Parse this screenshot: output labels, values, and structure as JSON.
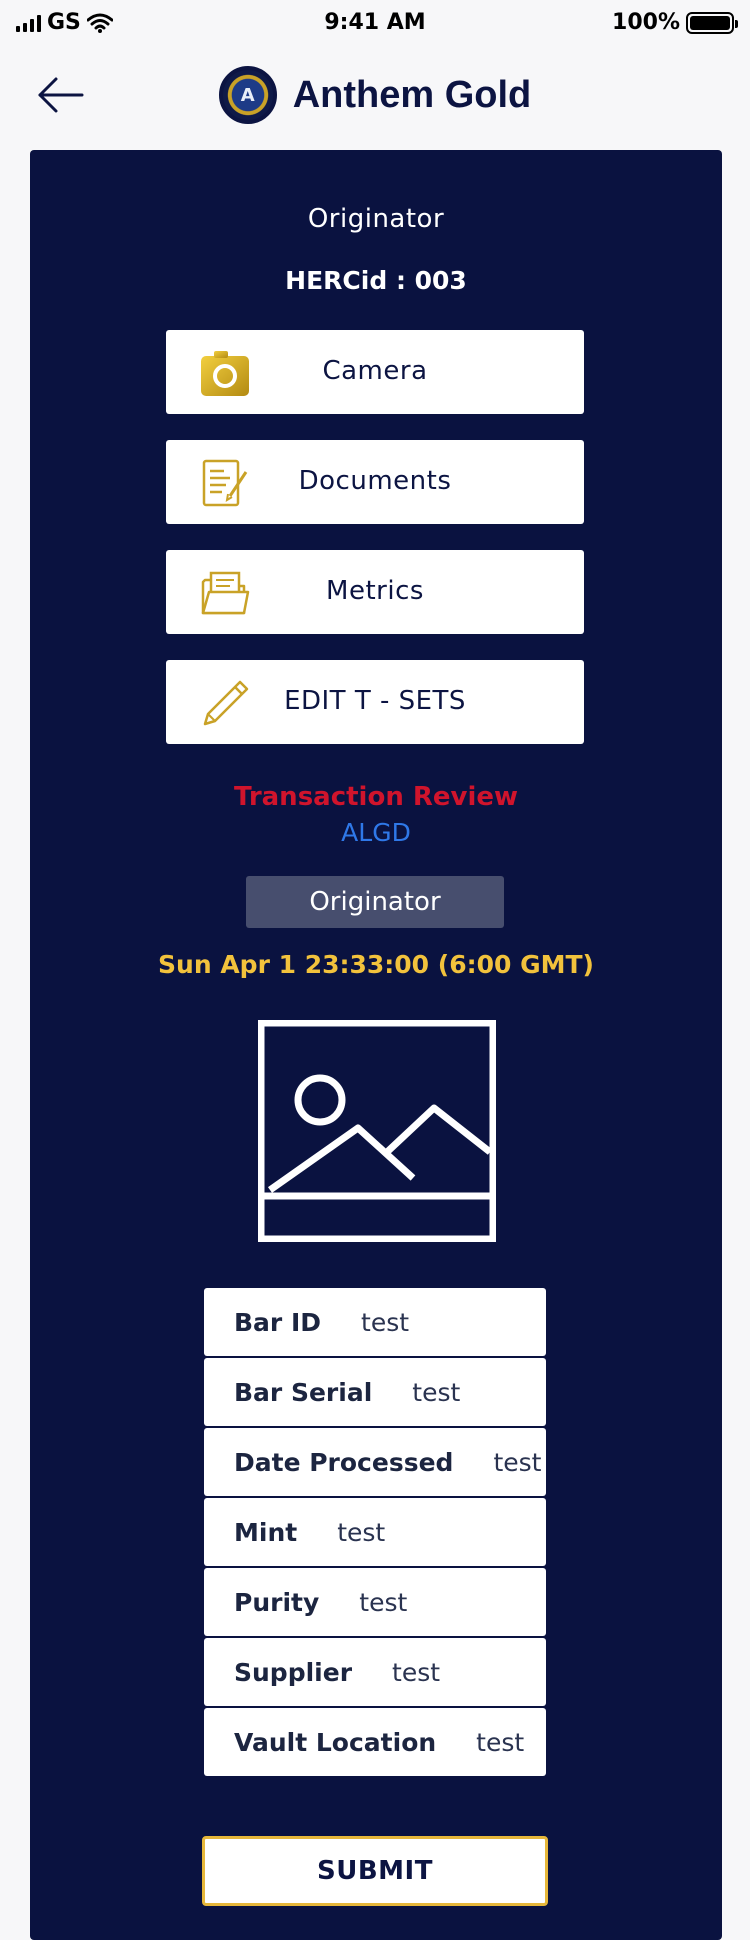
{
  "status_bar": {
    "carrier": "GS",
    "time": "9:41 AM",
    "battery": "100%"
  },
  "header": {
    "title": "Anthem Gold",
    "logo_text": "A"
  },
  "panel": {
    "role": "Originator",
    "hercid": "HERCid : 003",
    "buttons": [
      {
        "label": "Camera",
        "icon": "camera-icon"
      },
      {
        "label": "Documents",
        "icon": "document-icon"
      },
      {
        "label": "Metrics",
        "icon": "folder-icon"
      },
      {
        "label": "EDIT T - SETS",
        "icon": "pencil-icon"
      }
    ],
    "transaction_review": "Transaction Review",
    "currency": "ALGD",
    "role_badge": "Originator",
    "timestamp": "Sun Apr 1 23:33:00 (6:00 GMT)",
    "details": [
      {
        "key": "Bar ID",
        "value": "test"
      },
      {
        "key": "Bar Serial",
        "value": "test"
      },
      {
        "key": "Date Processed",
        "value": "test"
      },
      {
        "key": "Mint",
        "value": "test"
      },
      {
        "key": "Purity",
        "value": "test"
      },
      {
        "key": "Supplier",
        "value": "test"
      },
      {
        "key": "Vault Location",
        "value": "test"
      }
    ],
    "submit_label": "SUBMIT"
  },
  "colors": {
    "panel_bg": "#0a1240",
    "gold": "#c9a227",
    "review_red": "#d0142c",
    "algd_blue": "#2f78e8",
    "timestamp_yellow": "#f2c23c",
    "badge_bg": "#474e6e"
  }
}
